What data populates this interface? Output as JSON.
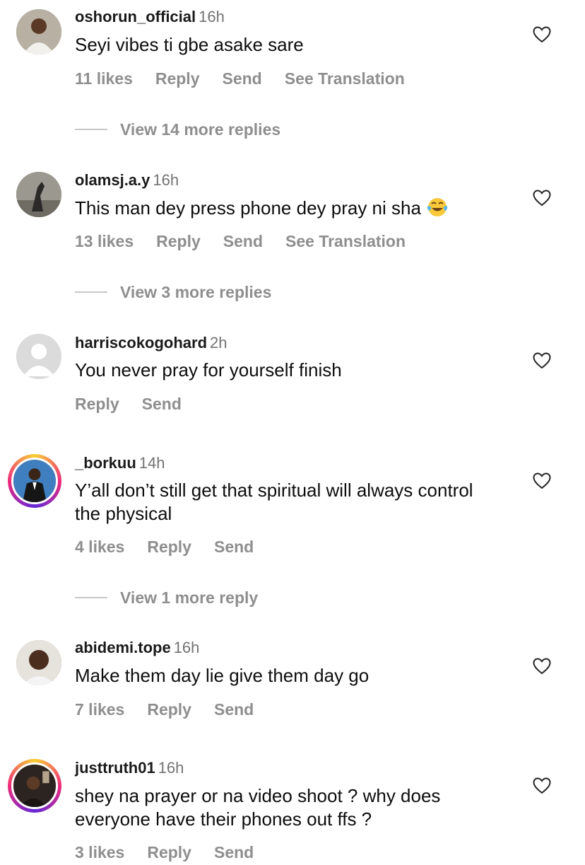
{
  "comments": [
    {
      "username": "oshorun_official",
      "time": "16h",
      "text": "Seyi vibes ti gbe asake sare",
      "likes": "11 likes",
      "reply": "Reply",
      "send": "Send",
      "translate": "See Translation",
      "view_replies": "View 14 more replies"
    },
    {
      "username": "olamsj.a.y",
      "time": "16h",
      "text": "This man dey press phone dey pray ni sha",
      "likes": "13 likes",
      "reply": "Reply",
      "send": "Send",
      "translate": "See Translation",
      "view_replies": "View 3 more replies"
    },
    {
      "username": "harriscokogohard",
      "time": "2h",
      "text": "You never pray for yourself finish",
      "reply": "Reply",
      "send": "Send"
    },
    {
      "username": "_borkuu",
      "time": "14h",
      "text": "Y’all don’t still get that spiritual will always control the physical",
      "likes": "4 likes",
      "reply": "Reply",
      "send": "Send",
      "view_replies": "View 1 more reply"
    },
    {
      "username": "abidemi.tope",
      "time": "16h",
      "text": "Make them day lie give them day go",
      "likes": "7 likes",
      "reply": "Reply",
      "send": "Send"
    },
    {
      "username": "justtruth01",
      "time": "16h",
      "text": "shey na prayer or na video shoot ? why does everyone have their phones out ffs ?",
      "likes": "3 likes",
      "reply": "Reply",
      "send": "Send"
    }
  ],
  "icons": {
    "heart": "heart-outline-icon",
    "emoji": "tears-of-joy-emoji"
  },
  "colors": {
    "secondary_text": "#8e8e8e",
    "story_ring": "#ee2a7b"
  }
}
